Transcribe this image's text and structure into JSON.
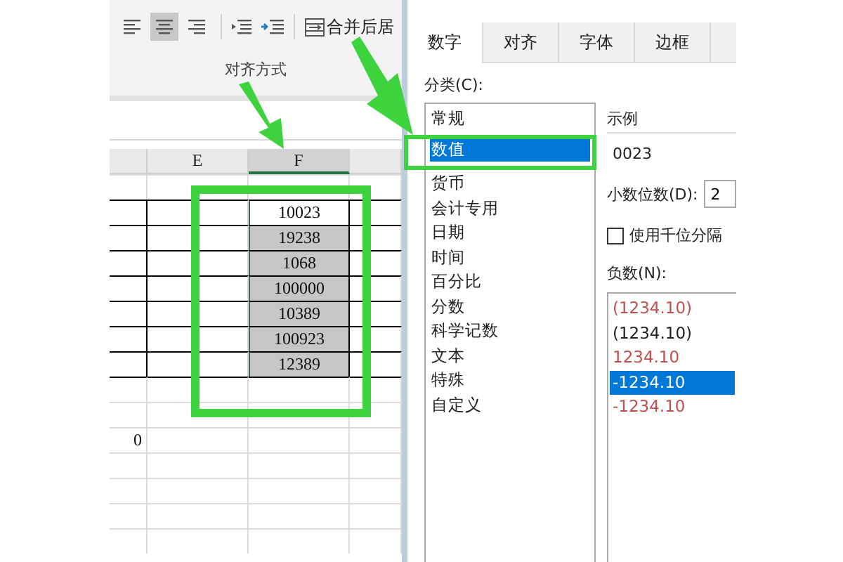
{
  "ribbon": {
    "align_buttons": [
      {
        "selected": false
      },
      {
        "selected": true
      },
      {
        "selected": false
      }
    ],
    "merge_label": "合并后居",
    "group_label": "对齐方式"
  },
  "sheet": {
    "columns": [
      {
        "selected": false
      },
      {
        "label": "E",
        "selected": false
      },
      {
        "label": "F",
        "selected": true
      },
      {
        "selected": false
      }
    ],
    "values": [
      {
        "value": "10023",
        "active": true
      },
      {
        "value": "19238",
        "active": false
      },
      {
        "value": "1068",
        "active": false
      },
      {
        "value": "100000",
        "active": false
      },
      {
        "value": "10389",
        "active": false
      },
      {
        "value": "100923",
        "active": false
      },
      {
        "value": "12389",
        "active": false
      }
    ],
    "other_value": "0"
  },
  "dialog": {
    "tabs": [
      {
        "label": "数字",
        "selected": true
      },
      {
        "label": "对齐",
        "selected": false
      },
      {
        "label": "字体",
        "selected": false
      },
      {
        "label": "边框",
        "selected": false
      }
    ],
    "category_label": "分类(C):",
    "categories": [
      {
        "label": "常规",
        "selected": false
      },
      {
        "label": "数值",
        "selected": true
      },
      {
        "label": "货币",
        "selected": false
      },
      {
        "label": "会计专用",
        "selected": false
      },
      {
        "label": "日期",
        "selected": false
      },
      {
        "label": "时间",
        "selected": false
      },
      {
        "label": "百分比",
        "selected": false
      },
      {
        "label": "分数",
        "selected": false
      },
      {
        "label": "科学记数",
        "selected": false
      },
      {
        "label": "文本",
        "selected": false
      },
      {
        "label": "特殊",
        "selected": false
      },
      {
        "label": "自定义",
        "selected": false
      }
    ],
    "sample_label": "示例",
    "sample_value": "0023",
    "decimals_label": "小数位数(D):",
    "decimals_value": "2",
    "thousands_checkbox": {
      "label": "使用千位分隔",
      "checked": false
    },
    "negative_label": "负数(N):",
    "negative_formats": [
      {
        "label": "(1234.10)",
        "color": "#c0504d",
        "selected": false
      },
      {
        "label": "(1234.10)",
        "color": "#222222",
        "selected": false
      },
      {
        "label": "1234.10",
        "color": "#c0504d",
        "selected": false
      },
      {
        "label": "-1234.10",
        "selected": true
      },
      {
        "label": "-1234.10",
        "color": "#c0504d",
        "selected": false
      }
    ]
  }
}
